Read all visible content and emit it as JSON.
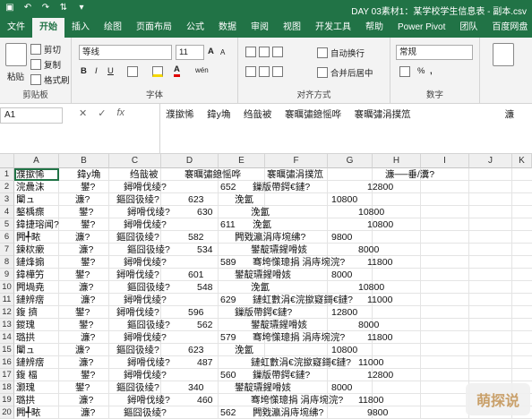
{
  "titlebar": {
    "qat_icons": [
      "save-icon",
      "undo-icon",
      "redo-icon",
      "sort-icon",
      "customize-icon"
    ],
    "title": "DAY 03素材1：某学校学生信息表 - 副本.csv"
  },
  "tabs": [
    "文件",
    "开始",
    "插入",
    "绘图",
    "页面布局",
    "公式",
    "数据",
    "审阅",
    "视图",
    "开发工具",
    "帮助",
    "Power Pivot",
    "团队",
    "百度网盘"
  ],
  "active_tab": "开始",
  "ribbon": {
    "clipboard": {
      "paste": "粘贴",
      "cut": "剪切",
      "copy": "复制",
      "format_painter": "格式刷",
      "group_label": "剪贴板"
    },
    "font": {
      "font_name": "等线",
      "font_size": "11",
      "bold": "B",
      "italic": "I",
      "underline": "U",
      "grow": "A",
      "shrink": "A",
      "font_color": "A",
      "wen": "wén",
      "group_label": "字体"
    },
    "alignment": {
      "wrap": "自动换行",
      "merge": "合并后居中",
      "group_label": "对齐方式"
    },
    "number": {
      "format": "常规",
      "percent": "%",
      "comma": ",",
      "group_label": "数字"
    }
  },
  "formula_bar": {
    "namebox": "A1",
    "cancel": "✕",
    "enter": "✓",
    "fx": "fx",
    "content": "濮撳悕     鍏у埆     绉戠被     褰曞彇鎴愮哗     褰曞彇涓撲笟                                    濂"
  },
  "columns": [
    "A",
    "B",
    "C",
    "D",
    "E",
    "F",
    "G",
    "H",
    "I",
    "J",
    "K"
  ],
  "rows": [
    [
      "濮撳悕",
      "鍏у埆",
      "绉戠被",
      "褰曞彇鎴愮哗",
      "褰曞彇涓撲笟",
      "",
      "",
      "",
      "濂──垂/瀵?"
    ],
    [
      "浣曟沫",
      "鐢?",
      "鐞嗗伐绫?",
      "652",
      "鏁版帶鍔€鏈?",
      "12800"
    ],
    [
      "闈ュ",
      "濂?",
      "鏂囧彶绫?",
      "623",
      "浼氳",
      "10800"
    ],
    [
      "鏊楀瘝",
      "鐢?",
      "鐞嗗伐绫?",
      "630",
      "浼氳",
      "10800"
    ],
    [
      "鍏捷瑢闻?",
      "鐢?",
      "鐞嗗伐绫?",
      "611",
      "浼氳",
      "10800"
    ],
    [
      "闁╃畩",
      "濂?",
      "鏂囧彶绫?",
      "582",
      "闁戣瀛涓庤埦绋?",
      "9800"
    ],
    [
      "鍊栨瘶",
      "濂?",
      "鏂囧彶绫?",
      "534",
      "鐢靛瓙鍟嗗姟",
      "8000"
    ],
    [
      "鏈烽搧",
      "鐢?",
      "鐞嗗伐绫?",
      "589",
      "骞垮憡璁捐 涓庤埦浣?",
      "11800"
    ],
    [
      "鍏樺竻",
      "鐢?",
      "鐞嗗伐绫?",
      "601",
      "鐢靛瓙鍟嗗姟",
      "8000"
    ],
    [
      "闁堝尭",
      "濂?",
      "鏂囧彶绫?",
      "548",
      "浼氳",
      "10800"
    ],
    [
      "鏈辨瘔",
      "濂?",
      "鐞嗗伐绫?",
      "629",
      "鏈虹數涓€浣撳寲鎶€鏈?",
      "11000"
    ],
    [
      "鍑 擠",
      "鐢?",
      "鐞嗗伐绫?",
      "596",
      "鏁版帶鍔€鏈?",
      "12800"
    ],
    [
      "鍐瑰",
      "鐢?",
      "鏂囧彶绫?",
      "562",
      "鐢靛瓙鍟嗗姟",
      "8000"
    ],
    [
      "璐拱",
      "濂?",
      "鐞嗗伐绫?",
      "579",
      "骞垮憡璁捐 涓庤埦浣?",
      "11800"
    ],
    [
      "闈ュ",
      "濂?",
      "鏂囧彶绫?",
      "623",
      "浼氳",
      "10800"
    ],
    [
      "鏈辨瘔",
      "濂?",
      "鐞嗗伐绫?",
      "487",
      "鏈虹數涓€浣撳寲鎶€鏈?",
      "11000"
    ],
    [
      "鍑 楅",
      "鐢?",
      "鐞嗗伐绫?",
      "560",
      "鏁版帶鍔€鏈?",
      "12800"
    ],
    [
      "灏瑰",
      "鐢?",
      "鏂囧彶绫?",
      "340",
      "鐢靛瓙鍟嗗姟",
      "8000"
    ],
    [
      "璐拱",
      "濂?",
      "鐞嗗伐绫?",
      "460",
      "骞垮憡璁捐 涓庤埦浣?",
      "11800"
    ],
    [
      "闁╃畩",
      "濂?",
      "鏂囧彶绫?",
      "562",
      "闁戣瀛涓庤埦绋?",
      "9800"
    ]
  ],
  "watermark": "萌探说",
  "colors": {
    "accent": "#217346",
    "selection": "#217346"
  }
}
